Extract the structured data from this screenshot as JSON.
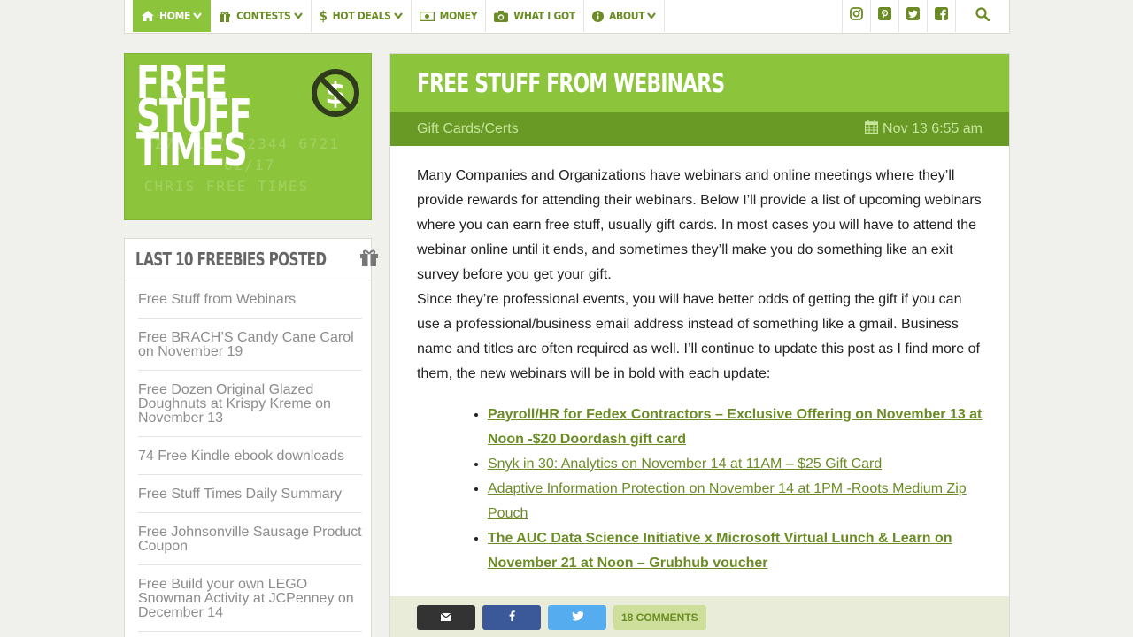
{
  "nav": {
    "items": [
      {
        "label": "HOME",
        "icon": "home-icon",
        "dropdown": true
      },
      {
        "label": "CONTESTS",
        "icon": "gift-icon",
        "dropdown": true
      },
      {
        "label": "HOT DEALS",
        "icon": "dollar-icon",
        "dropdown": true
      },
      {
        "label": "MONEY",
        "icon": "money-icon",
        "dropdown": false
      },
      {
        "label": "WHAT I GOT",
        "icon": "camera-icon",
        "dropdown": false
      },
      {
        "label": "ABOUT",
        "icon": "info-icon",
        "dropdown": true
      }
    ],
    "social": [
      "instagram-icon",
      "pinterest-icon",
      "twitter-icon",
      "facebook-icon",
      "search-icon"
    ]
  },
  "logo": {
    "lines": [
      "FREE",
      "STUFF",
      "TIMES"
    ],
    "card_number": "4275 1478 2344 6721",
    "card_expiry": "02/17",
    "card_name": "CHRIS FREE TIMES"
  },
  "sidebar": {
    "title": "LAST 10 FREEBIES POSTED",
    "items": [
      "Free Stuff from Webinars",
      "Free BRACH’S Candy Cane Carol on November 19",
      "Free Dozen Original Glazed Doughnuts at Krispy Kreme on November 13",
      "74 Free Kindle ebook downloads",
      "Free Stuff Times Daily Summary",
      "Free Johnsonville Sausage Product Coupon",
      "Free Build your own LEGO Snowman Activity at JCPenney on December 14"
    ]
  },
  "post": {
    "title": "FREE STUFF FROM WEBINARS",
    "category": "Gift Cards/Certs",
    "date": "Nov 13 6:55 am",
    "paragraph1": "Many Companies and Organizations have webinars and online meetings where they’ll provide rewards for attending their webinars. Below I’ll provide a list of upcoming webinars where you can earn free stuff, usually gift cards. In most cases you will have to attend the webinar online until it ends, and sometimes they’ll make you do something like an exit survey before you get your gift.",
    "paragraph2": "Since they’re professional events, you will have better odds of getting the gift if you can use a professional/business email address instead of something like a gmail. Business name and titles are often required as well. I’ll continue to update this post as I find more of them, the new webinars will be in bold with each update:",
    "links": [
      {
        "text": "Payroll/HR for Fedex Contractors – Exclusive Offering on November 13 at Noon -$20 Doordash gift card",
        "bold": true
      },
      {
        "text": "Snyk in 30: Analytics on November 14 at 11AM – $25 Gift Card",
        "bold": false
      },
      {
        "text": "Adaptive Information Protection on November 14 at 1PM -Roots Medium Zip Pouch",
        "bold": false
      },
      {
        "text": "The AUC Data Science Initiative x Microsoft Virtual Lunch & Learn on November 21 at Noon – Grubhub voucher",
        "bold": true
      }
    ],
    "comments_label": "18 COMMENTS"
  },
  "colors": {
    "accent": "#8cc43c",
    "accent_dark": "#6a9a26",
    "link": "#6b8c25"
  }
}
